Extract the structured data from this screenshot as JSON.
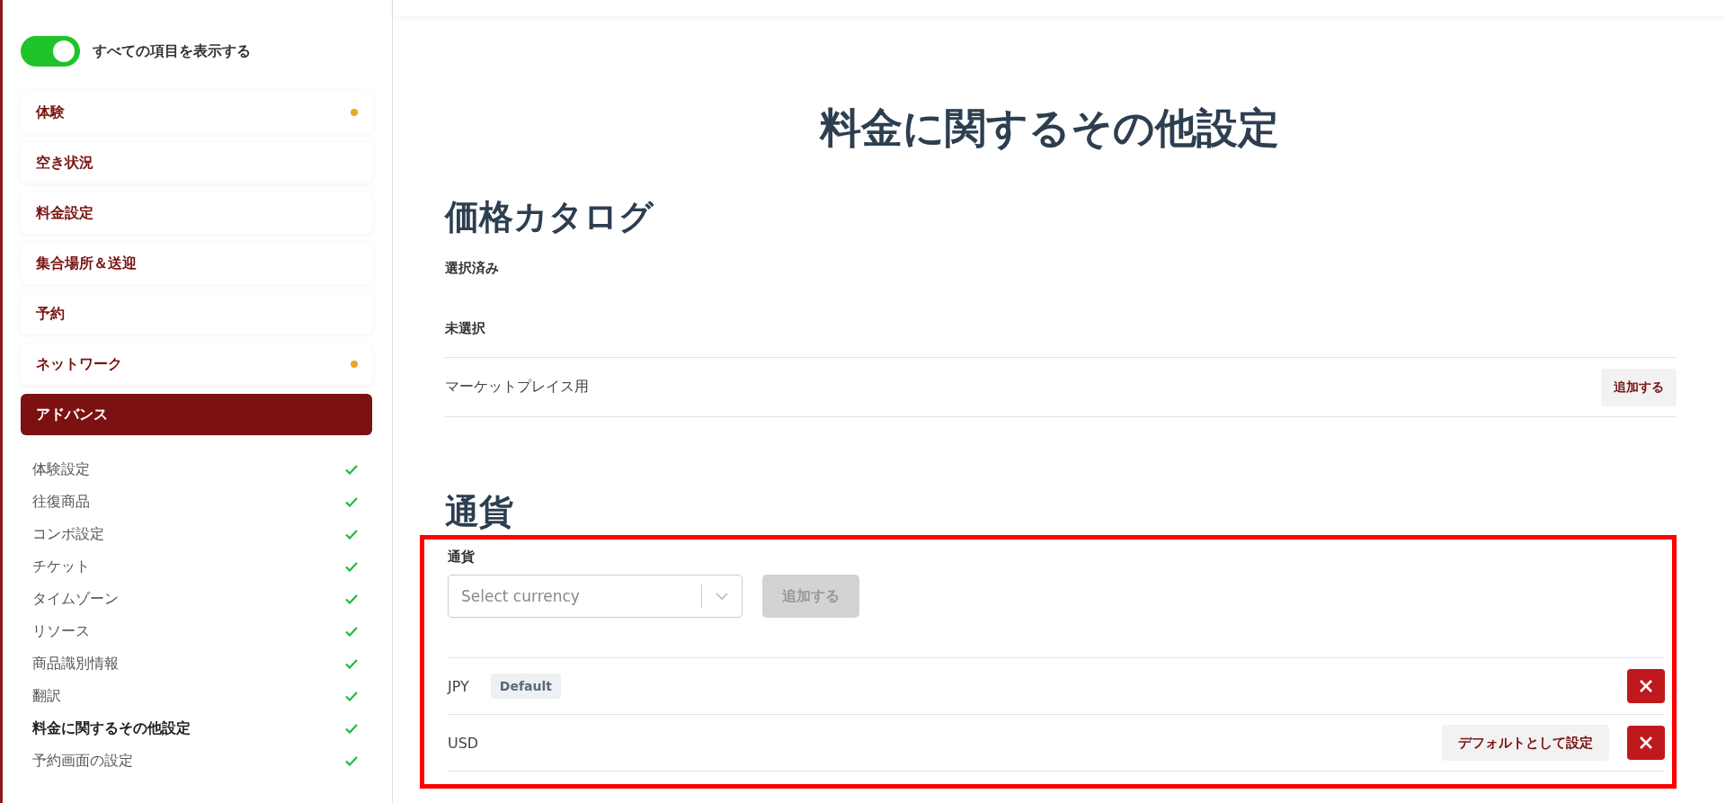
{
  "sidebar": {
    "show_all_toggle": {
      "label": "すべての項目を表示する",
      "on": true
    },
    "sections": [
      {
        "label": "体験",
        "selected": false,
        "pending": true
      },
      {
        "label": "空き状況",
        "selected": false,
        "pending": false
      },
      {
        "label": "料金設定",
        "selected": false,
        "pending": false
      },
      {
        "label": "集合場所＆送迎",
        "selected": false,
        "pending": false
      },
      {
        "label": "予約",
        "selected": false,
        "pending": false
      },
      {
        "label": "ネットワーク",
        "selected": false,
        "pending": true
      },
      {
        "label": "アドバンス",
        "selected": true,
        "pending": false
      }
    ],
    "subitems": [
      {
        "label": "体験設定",
        "selected": false,
        "done": true
      },
      {
        "label": "往復商品",
        "selected": false,
        "done": true
      },
      {
        "label": "コンボ設定",
        "selected": false,
        "done": true
      },
      {
        "label": "チケット",
        "selected": false,
        "done": true
      },
      {
        "label": "タイムゾーン",
        "selected": false,
        "done": true
      },
      {
        "label": "リソース",
        "selected": false,
        "done": true
      },
      {
        "label": "商品識別情報",
        "selected": false,
        "done": true
      },
      {
        "label": "翻訳",
        "selected": false,
        "done": true
      },
      {
        "label": "料金に関するその他設定",
        "selected": true,
        "done": true
      },
      {
        "label": "予約画面の設定",
        "selected": false,
        "done": true
      }
    ]
  },
  "page_title": "料金に関するその他設定",
  "price_catalog": {
    "heading": "価格カタログ",
    "selected_label": "選択済み",
    "unselected_label": "未選択",
    "rows": [
      {
        "name": "マーケットプレイス用",
        "button": "追加する"
      }
    ]
  },
  "currency": {
    "heading": "通貨",
    "highlighted": true,
    "field_label": "通貨",
    "select_placeholder": "Select currency",
    "add_button": {
      "label": "追加する",
      "disabled": true
    },
    "rows": [
      {
        "code": "JPY",
        "default": true,
        "badge": "Default"
      },
      {
        "code": "USD",
        "default": false,
        "set_default_button": "デフォルトとして設定"
      }
    ]
  }
}
